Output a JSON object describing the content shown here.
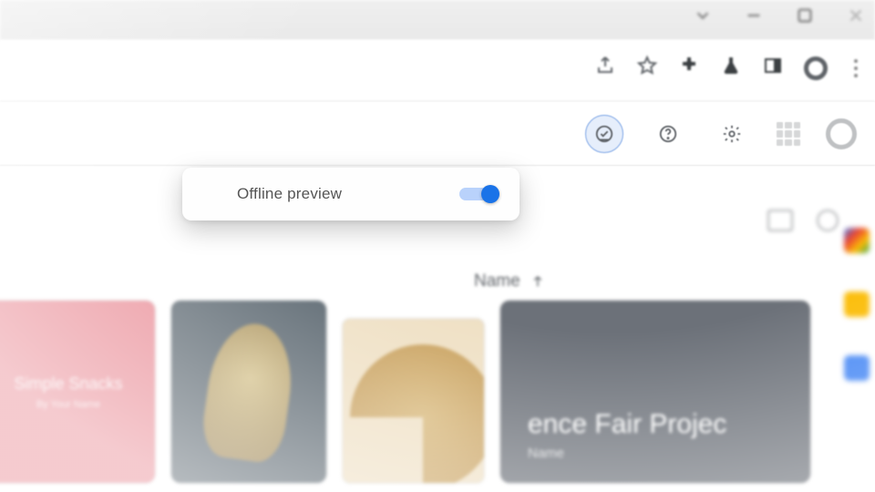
{
  "dropdown": {
    "label": "Offline preview",
    "toggle_on": true
  },
  "sort": {
    "label": "Name",
    "direction": "asc"
  },
  "files": {
    "card1_title": "Simple Snacks",
    "card1_subtitle": "By Your Name",
    "card4_title": "ence Fair Projec",
    "card4_subtitle": "Name"
  }
}
